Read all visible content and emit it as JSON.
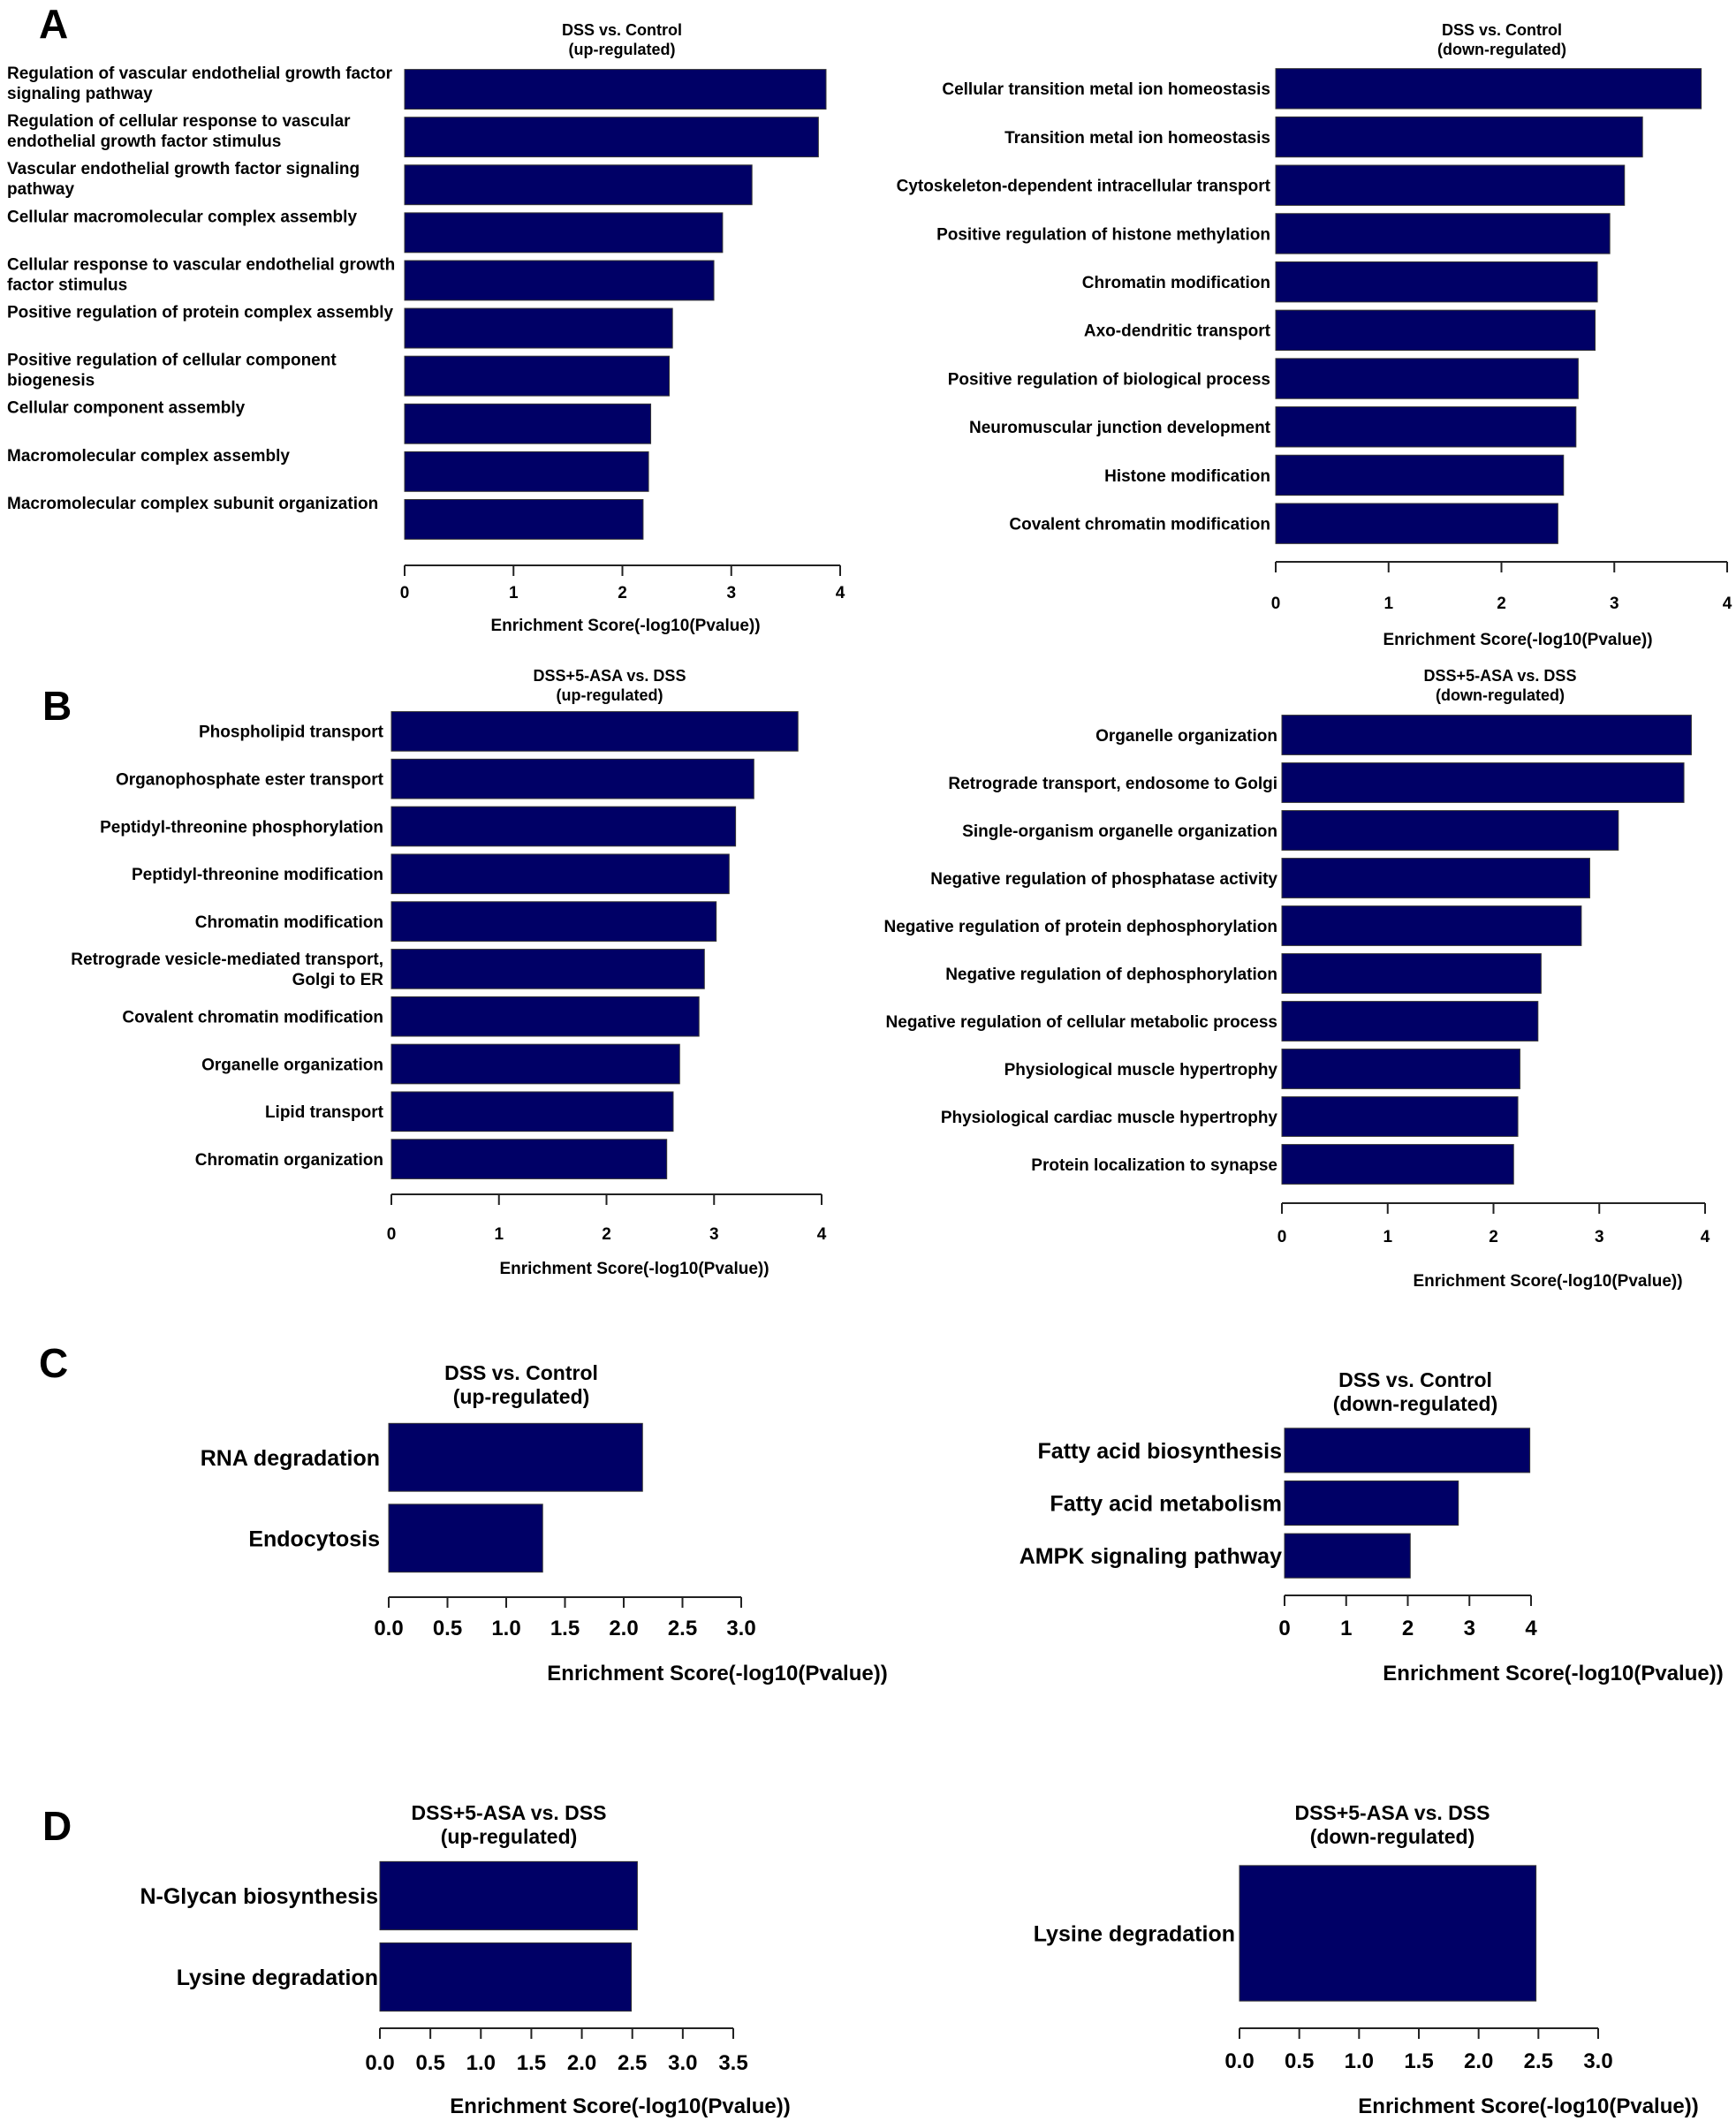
{
  "bar_color": "#000066",
  "panel_letters": [
    "A",
    "B",
    "C",
    "D"
  ],
  "chart_data": [
    {
      "id": "A-up",
      "panel": "A",
      "type": "bar",
      "orientation": "horizontal",
      "title": [
        "DSS vs. Control",
        "(up-regulated)"
      ],
      "xlabel": "Enrichment Score(-log10(Pvalue))",
      "xlim": [
        0,
        4
      ],
      "ticks": [
        0,
        1,
        2,
        3,
        4
      ],
      "tick_labels": [
        "0",
        "1",
        "2",
        "3",
        "4"
      ],
      "label_align": "left",
      "label_valign": "top",
      "categories": [
        [
          "Regulation of vascular endothelial growth factor",
          "signaling pathway"
        ],
        [
          "Regulation of cellular response to vascular",
          "endothelial growth factor stimulus"
        ],
        [
          "Vascular endothelial growth factor signaling",
          "pathway"
        ],
        [
          "Cellular macromolecular complex assembly"
        ],
        [
          "Cellular response to vascular endothelial growth",
          "factor stimulus"
        ],
        [
          "Positive regulation of protein complex assembly"
        ],
        [
          "Positive regulation of cellular component",
          "biogenesis"
        ],
        [
          "Cellular component assembly"
        ],
        [
          "Macromolecular complex assembly"
        ],
        [
          "Macromolecular complex subunit organization"
        ]
      ],
      "values": [
        3.87,
        3.8,
        3.19,
        2.92,
        2.84,
        2.46,
        2.43,
        2.26,
        2.24,
        2.19
      ]
    },
    {
      "id": "A-down",
      "panel": "A",
      "type": "bar",
      "orientation": "horizontal",
      "title": [
        "DSS vs. Control",
        "(down-regulated)"
      ],
      "xlabel": "Enrichment Score(-log10(Pvalue))",
      "xlim": [
        0,
        4
      ],
      "ticks": [
        0,
        1,
        2,
        3,
        4
      ],
      "tick_labels": [
        "0",
        "1",
        "2",
        "3",
        "4"
      ],
      "label_align": "right",
      "label_valign": "middle",
      "categories": [
        [
          "Cellular transition metal ion homeostasis"
        ],
        [
          "Transition metal ion homeostasis"
        ],
        [
          "Cytoskeleton-dependent intracellular transport"
        ],
        [
          "Positive regulation of histone methylation"
        ],
        [
          "Chromatin modification"
        ],
        [
          "Axo-dendritic transport"
        ],
        [
          "Positive regulation of biological process"
        ],
        [
          "Neuromuscular junction development"
        ],
        [
          "Histone modification"
        ],
        [
          "Covalent chromatin modification"
        ]
      ],
      "values": [
        3.77,
        3.25,
        3.09,
        2.96,
        2.85,
        2.83,
        2.68,
        2.66,
        2.55,
        2.5
      ]
    },
    {
      "id": "B-up",
      "panel": "B",
      "type": "bar",
      "orientation": "horizontal",
      "title": [
        "DSS+5-ASA vs. DSS",
        "(up-regulated)"
      ],
      "xlabel": "Enrichment Score(-log10(Pvalue))",
      "xlim": [
        0,
        4
      ],
      "ticks": [
        0,
        1,
        2,
        3,
        4
      ],
      "tick_labels": [
        "0",
        "1",
        "2",
        "3",
        "4"
      ],
      "label_align": "right",
      "label_valign": "middle",
      "categories": [
        [
          "Phospholipid transport"
        ],
        [
          "Organophosphate ester transport"
        ],
        [
          "Peptidyl-threonine phosphorylation"
        ],
        [
          "Peptidyl-threonine modification"
        ],
        [
          "Chromatin modification"
        ],
        [
          "Retrograde vesicle-mediated transport,",
          "Golgi to ER"
        ],
        [
          "Covalent chromatin modification"
        ],
        [
          "Organelle organization"
        ],
        [
          "Lipid transport"
        ],
        [
          "Chromatin organization"
        ]
      ],
      "values": [
        3.78,
        3.37,
        3.2,
        3.14,
        3.02,
        2.91,
        2.86,
        2.68,
        2.62,
        2.56
      ]
    },
    {
      "id": "B-down",
      "panel": "B",
      "type": "bar",
      "orientation": "horizontal",
      "title": [
        "DSS+5-ASA vs. DSS",
        "(down-regulated)"
      ],
      "xlabel": "Enrichment Score(-log10(Pvalue))",
      "xlim": [
        0,
        4
      ],
      "ticks": [
        0,
        1,
        2,
        3,
        4
      ],
      "tick_labels": [
        "0",
        "1",
        "2",
        "3",
        "4"
      ],
      "label_align": "right",
      "label_valign": "middle",
      "categories": [
        [
          "Organelle organization"
        ],
        [
          "Retrograde transport, endosome to Golgi"
        ],
        [
          "Single-organism organelle organization"
        ],
        [
          "Negative regulation of phosphatase activity"
        ],
        [
          "Negative regulation of protein dephosphorylation"
        ],
        [
          "Negative regulation of dephosphorylation"
        ],
        [
          "Negative regulation of cellular metabolic process"
        ],
        [
          "Physiological muscle hypertrophy"
        ],
        [
          "Physiological cardiac muscle hypertrophy"
        ],
        [
          "Protein localization to synapse"
        ]
      ],
      "values": [
        3.87,
        3.8,
        3.18,
        2.91,
        2.83,
        2.45,
        2.42,
        2.25,
        2.23,
        2.19
      ]
    },
    {
      "id": "C-up",
      "panel": "C",
      "type": "bar",
      "orientation": "horizontal",
      "title": [
        "DSS vs. Control",
        "(up-regulated)"
      ],
      "xlabel": "Enrichment Score(-log10(Pvalue))",
      "xlim": [
        0,
        3
      ],
      "ticks": [
        0,
        0.5,
        1,
        1.5,
        2,
        2.5,
        3
      ],
      "tick_labels": [
        "0.0",
        "0.5",
        "1.0",
        "1.5",
        "2.0",
        "2.5",
        "3.0"
      ],
      "label_align": "right",
      "label_valign": "middle",
      "categories": [
        [
          "RNA degradation"
        ],
        [
          "Endocytosis"
        ]
      ],
      "values": [
        2.16,
        1.31
      ]
    },
    {
      "id": "C-down",
      "panel": "C",
      "type": "bar",
      "orientation": "horizontal",
      "title": [
        "DSS vs. Control",
        "(down-regulated)"
      ],
      "xlabel": "Enrichment Score(-log10(Pvalue))",
      "xlim": [
        0,
        4
      ],
      "ticks": [
        0,
        1,
        2,
        3,
        4
      ],
      "tick_labels": [
        "0",
        "1",
        "2",
        "3",
        "4"
      ],
      "label_align": "right",
      "label_valign": "middle",
      "categories": [
        [
          "Fatty acid biosynthesis"
        ],
        [
          "Fatty acid metabolism"
        ],
        [
          "AMPK signaling pathway"
        ]
      ],
      "values": [
        3.98,
        2.82,
        2.04
      ]
    },
    {
      "id": "D-up",
      "panel": "D",
      "type": "bar",
      "orientation": "horizontal",
      "title": [
        "DSS+5-ASA vs. DSS",
        "(up-regulated)"
      ],
      "xlabel": "Enrichment Score(-log10(Pvalue))",
      "xlim": [
        0,
        3.5
      ],
      "ticks": [
        0,
        0.5,
        1,
        1.5,
        2,
        2.5,
        3,
        3.5
      ],
      "tick_labels": [
        "0.0",
        "0.5",
        "1.0",
        "1.5",
        "2.0",
        "2.5",
        "3.0",
        "3.5"
      ],
      "label_align": "right",
      "label_valign": "middle",
      "categories": [
        [
          "N-Glycan biosynthesis"
        ],
        [
          "Lysine degradation"
        ]
      ],
      "values": [
        2.55,
        2.49
      ]
    },
    {
      "id": "D-down",
      "panel": "D",
      "type": "bar",
      "orientation": "horizontal",
      "title": [
        "DSS+5-ASA vs. DSS",
        "(down-regulated)"
      ],
      "xlabel": "Enrichment Score(-log10(Pvalue))",
      "xlim": [
        0,
        3
      ],
      "ticks": [
        0,
        0.5,
        1,
        1.5,
        2,
        2.5,
        3
      ],
      "tick_labels": [
        "0.0",
        "0.5",
        "1.0",
        "1.5",
        "2.0",
        "2.5",
        "3.0"
      ],
      "label_align": "right",
      "label_valign": "middle",
      "categories": [
        [
          "Lysine degradation"
        ]
      ],
      "values": [
        2.48
      ]
    }
  ]
}
